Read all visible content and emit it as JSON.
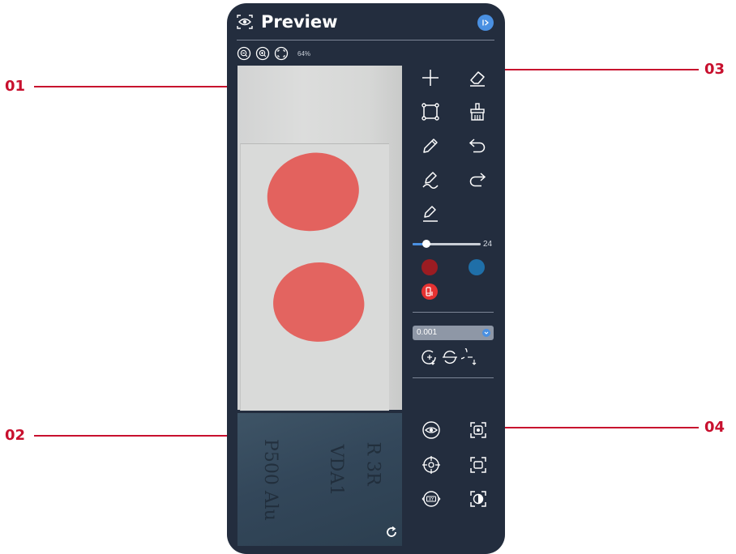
{
  "callouts": [
    {
      "id": "01",
      "label": "01"
    },
    {
      "id": "02",
      "label": "02"
    },
    {
      "id": "03",
      "label": "03"
    },
    {
      "id": "04",
      "label": "04"
    }
  ],
  "panel": {
    "title": "Preview",
    "zoom": {
      "level": "64%",
      "buttons": [
        "zoom-out-icon",
        "zoom-in-icon",
        "fit-icon"
      ]
    },
    "tools": {
      "row1": [
        "plus-icon",
        "eraser-icon"
      ],
      "row2": [
        "rectangle-select-icon",
        "brush-icon"
      ],
      "row3": [
        "pencil-icon",
        "undo-icon"
      ],
      "row4": [
        "pen-stroke-icon",
        "redo-icon"
      ],
      "row5": [
        "highlighter-icon"
      ]
    },
    "brush_size": {
      "value": "24",
      "fraction": 0.2
    },
    "colors": {
      "primary": "#9b1c22",
      "secondary": "#1f6fa8",
      "fg_chip": "#e63232"
    },
    "threshold": {
      "value": "0.001"
    },
    "view_tools": [
      "eye-view-icon",
      "focus-frame-icon",
      "target-icon",
      "camera-frame-icon",
      "xy-rotate-icon",
      "contrast-icon"
    ],
    "thumbnail_text": [
      "R 3R",
      "VDA1",
      "P500 Alu"
    ],
    "accent": "#4a90e2",
    "panel_bg": "#232d3e"
  }
}
